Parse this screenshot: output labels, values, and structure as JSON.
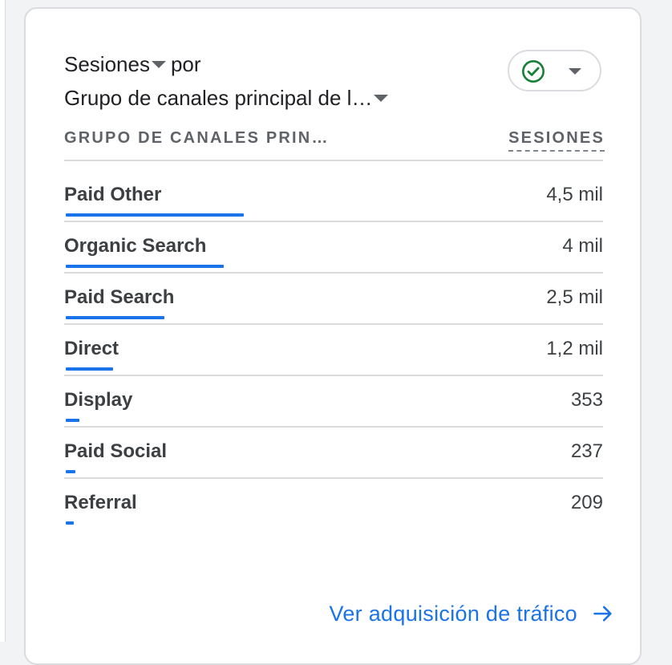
{
  "card": {
    "metric": "Sesiones",
    "connector": "por",
    "dimension": "Grupo de canales principal de l…",
    "compare_icon": "check-circle-icon",
    "dropdown_icon": "caret-down-icon"
  },
  "table": {
    "col_dimension": "GRUPO DE CANALES PRIN…",
    "col_metric": "SESIONES",
    "bar_color": "#1a73e8",
    "rows": [
      {
        "label": "Paid Other",
        "value": "4,5 mil",
        "sessions": 4500
      },
      {
        "label": "Organic Search",
        "value": "4 mil",
        "sessions": 4000
      },
      {
        "label": "Paid Search",
        "value": "2,5 mil",
        "sessions": 2500
      },
      {
        "label": "Direct",
        "value": "1,2 mil",
        "sessions": 1200
      },
      {
        "label": "Display",
        "value": "353",
        "sessions": 353
      },
      {
        "label": "Paid Social",
        "value": "237",
        "sessions": 237
      },
      {
        "label": "Referral",
        "value": "209",
        "sessions": 209
      }
    ]
  },
  "footer": {
    "link_label": "Ver adquisición de tráfico",
    "link_icon": "arrow-right-icon"
  },
  "colors": {
    "accent": "#1a73e8",
    "check": "#188038"
  }
}
